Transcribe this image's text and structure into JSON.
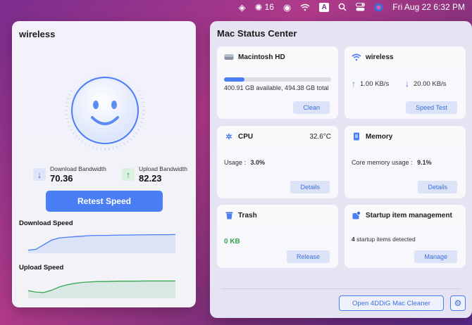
{
  "menubar": {
    "notification_count": "16",
    "keyboard_input": "A",
    "datetime": "Fri Aug 22  6:32 PM"
  },
  "left": {
    "title": "wireless",
    "download_label": "Download Bandwidth",
    "download_value": "70.36",
    "upload_label": "Upload Bandwidth",
    "upload_value": "82.23",
    "retest_label": "Retest Speed",
    "download_speed_title": "Download Speed",
    "upload_speed_title": "Upload Speed"
  },
  "charts": {
    "download": {
      "values": [
        0.05,
        0.1,
        0.35,
        0.6,
        0.72,
        0.76,
        0.79,
        0.82,
        0.85,
        0.86,
        0.86,
        0.87,
        0.88,
        0.88,
        0.89,
        0.89,
        0.9,
        0.9,
        0.9,
        0.91
      ],
      "color": "#4a7ef5"
    },
    "upload": {
      "values": [
        0.3,
        0.22,
        0.2,
        0.32,
        0.5,
        0.62,
        0.7,
        0.75,
        0.78,
        0.8,
        0.8,
        0.81,
        0.82,
        0.82,
        0.82,
        0.83,
        0.83,
        0.83,
        0.83,
        0.83
      ],
      "color": "#34a853"
    }
  },
  "right": {
    "title": "Mac Status Center",
    "disk": {
      "name": "Macintosh HD",
      "usage_text": "400.91 GB available, 494.38 GB total",
      "used_fraction": 0.19,
      "button": "Clean"
    },
    "wireless": {
      "name": "wireless",
      "up_value": "1.00 KB/s",
      "down_value": "20.00 KB/s",
      "button": "Speed Test"
    },
    "cpu": {
      "name": "CPU",
      "temp": "32.6°C",
      "usage_label": "Usage :",
      "usage_value": "3.0%",
      "button": "Details"
    },
    "memory": {
      "name": "Memory",
      "usage_label": "Core memory usage :",
      "usage_value": "9.1%",
      "button": "Details"
    },
    "trash": {
      "name": "Trash",
      "value": "0  KB",
      "button": "Release"
    },
    "startup": {
      "name": "Startup item management",
      "count": "4",
      "detected_text": "startup items detected",
      "button": "Manage"
    },
    "open_button": "Open 4DDiG Mac Cleaner"
  },
  "colors": {
    "accent": "#4a7ef5",
    "green": "#34a853"
  }
}
